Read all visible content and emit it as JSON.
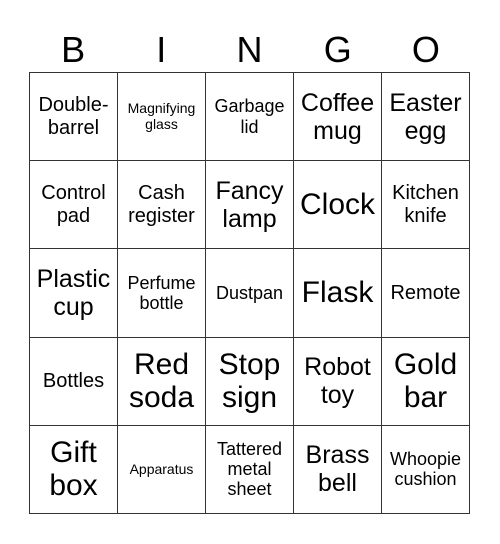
{
  "header": {
    "letters": [
      "B",
      "I",
      "N",
      "G",
      "O"
    ]
  },
  "cells": [
    [
      "Double-barrel",
      "Magnifying glass",
      "Garbage lid",
      "Coffee mug",
      "Easter egg"
    ],
    [
      "Control pad",
      "Cash register",
      "Fancy lamp",
      "Clock",
      "Kitchen knife"
    ],
    [
      "Plastic cup",
      "Perfume bottle",
      "Dustpan",
      "Flask",
      "Remote"
    ],
    [
      "Bottles",
      "Red soda",
      "Stop sign",
      "Robot toy",
      "Gold bar"
    ],
    [
      "Gift box",
      "Apparatus",
      "Tattered metal sheet",
      "Brass bell",
      "Whoopie cushion"
    ]
  ]
}
